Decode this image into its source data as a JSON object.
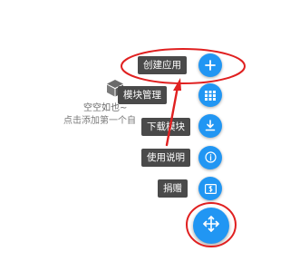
{
  "empty_state": {
    "line1": "空空如也~",
    "line2": "点击添加第一个自"
  },
  "fab_menu": {
    "items": [
      {
        "label": "创建应用",
        "icon": "plus-icon"
      },
      {
        "label": "模块管理",
        "icon": "grid-icon"
      },
      {
        "label": "下载模块",
        "icon": "download-icon"
      },
      {
        "label": "使用说明",
        "icon": "info-icon"
      },
      {
        "label": "捐赠",
        "icon": "donate-icon"
      }
    ],
    "main_icon": "move-arrows-icon"
  },
  "colors": {
    "fab": "#2196f3",
    "label_bg": "#4a4a4a",
    "annotation": "#e02020"
  }
}
